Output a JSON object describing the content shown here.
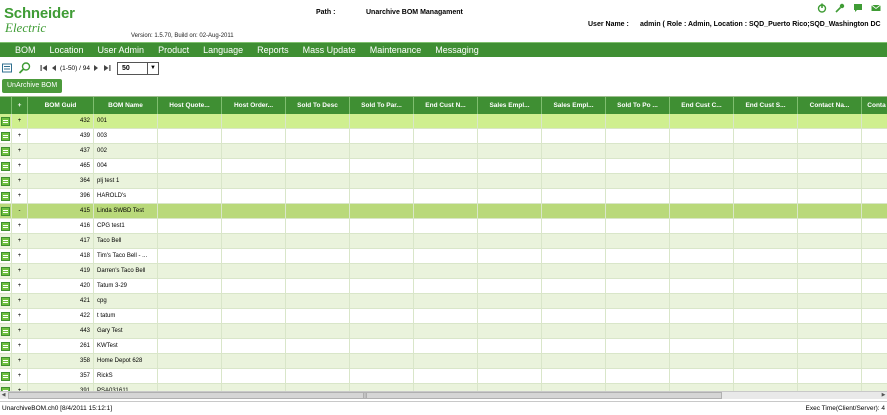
{
  "header": {
    "logo_line1": "Schneider",
    "logo_line2": "Electric",
    "version": "Version: 1.5.70, Build on: 02-Aug-2011",
    "path_label": "Path :",
    "path_value": "Unarchive BOM Managament",
    "user_label": "User Name :",
    "user_value": "admin ( Role : Admin, Location : SQD_Puerto Rico;SQD_Washington DC",
    "icons": [
      "power-icon",
      "key-icon",
      "help-icon",
      "mail-icon"
    ]
  },
  "menu": {
    "items": [
      "BOM",
      "Location",
      "User Admin",
      "Product",
      "Language",
      "Reports",
      "Mass Update",
      "Maintenance",
      "Messaging"
    ]
  },
  "toolbar": {
    "pager_text": "(1-50) / 94",
    "page_size": "50",
    "unarchive_label": "UnArchive BOM"
  },
  "grid": {
    "columns": [
      "",
      "+",
      "BOM Guid",
      "BOM Name",
      "Host Quote...",
      "Host Order...",
      "Sold To Desc",
      "Sold To Par...",
      "End Cust N...",
      "Sales Empl...",
      "Sales Empl...",
      "Sold To Po ...",
      "End Cust C...",
      "End Cust S...",
      "Contact Na...",
      "Conta"
    ],
    "rows": [
      {
        "guid": "432",
        "name": "001",
        "expand": "+"
      },
      {
        "guid": "439",
        "name": "003",
        "expand": "+"
      },
      {
        "guid": "437",
        "name": "002",
        "expand": "+"
      },
      {
        "guid": "465",
        "name": "004",
        "expand": "+"
      },
      {
        "guid": "364",
        "name": "plj test 1",
        "expand": "+"
      },
      {
        "guid": "396",
        "name": "HAROLD's",
        "expand": "+"
      },
      {
        "guid": "415",
        "name": "Linda SWBD Test",
        "expand": "-"
      },
      {
        "guid": "416",
        "name": "CPG test1",
        "expand": "+"
      },
      {
        "guid": "417",
        "name": "Taco Bell",
        "expand": "+"
      },
      {
        "guid": "418",
        "name": "Tim's Taco Bell - ...",
        "expand": "+"
      },
      {
        "guid": "419",
        "name": "Darren's Taco Bell",
        "expand": "+"
      },
      {
        "guid": "420",
        "name": "Tatum 3-29",
        "expand": "+"
      },
      {
        "guid": "421",
        "name": "cpg",
        "expand": "+"
      },
      {
        "guid": "422",
        "name": "t tatum",
        "expand": "+"
      },
      {
        "guid": "443",
        "name": "Gary Test",
        "expand": "+"
      },
      {
        "guid": "261",
        "name": "KWTest",
        "expand": "+"
      },
      {
        "guid": "358",
        "name": "Home Depot 628",
        "expand": "+"
      },
      {
        "guid": "357",
        "name": "RickS",
        "expand": "+"
      },
      {
        "guid": "391",
        "name": "PSA031611",
        "expand": "+"
      }
    ]
  },
  "status": {
    "left": "UnarchiveBOM.ch0 [8/4/2011 15:12:1]",
    "right": "Exec Time(Client/Server): 4"
  },
  "colors": {
    "brand_green": "#3f9c35",
    "menu_green": "#3f8f33",
    "row_alt": "#eaf3dc",
    "row_selected": "#cfef8f",
    "row_highlight": "#b9d97a"
  }
}
